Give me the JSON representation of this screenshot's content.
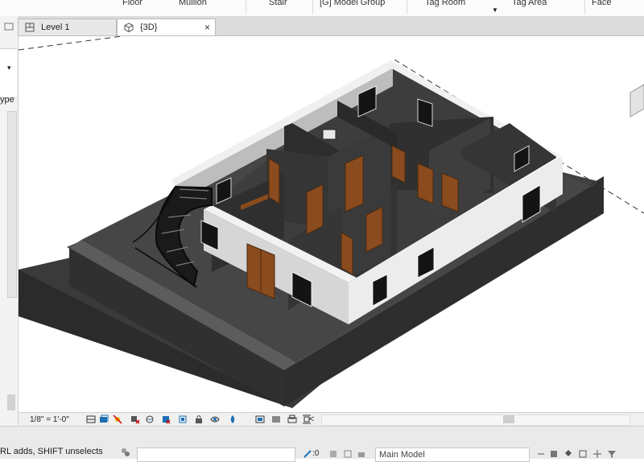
{
  "ribbon": {
    "items": [
      "Floor",
      "Mullion",
      "Stair",
      "[G] Model Group",
      "Tag Room",
      "Tag Area",
      "Face"
    ]
  },
  "left_panel": {
    "dropdown_arrow": "▾",
    "type_label": "ype"
  },
  "tabs": [
    {
      "label": "Level 1",
      "close": "×",
      "active": false
    },
    {
      "label": "{3D}",
      "close": "×",
      "active": true
    }
  ],
  "status": {
    "scale": "1/8\" = 1'-0\"",
    "scroll_left": "<"
  },
  "bottom": {
    "hint": "RL adds, SHIFT unselects",
    "count": ":0",
    "model": "Main Model"
  },
  "colors": {
    "wall_exterior_top": "#e9e9e9",
    "wall_dark": "#4a4a4a",
    "floor": "#3b3b3b",
    "base": "#2f2f2f",
    "door": "#8a4b1e",
    "accent": "#0a66c2"
  }
}
